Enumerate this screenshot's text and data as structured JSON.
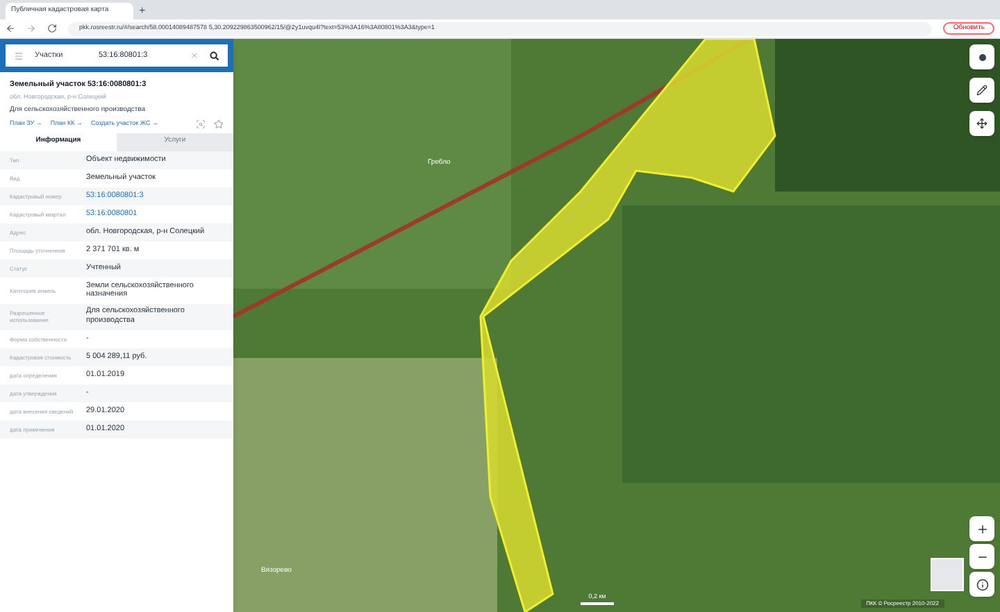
{
  "browser": {
    "tab_title": "Публичная кадастровая карта",
    "new_tab": "+",
    "url": "pkk.rosreestr.ru/#/search/58.00014089487578 5,30.209229863500962/15/@2y1uvqu4l?text=53%3A16%3A80801%3A3&type=1",
    "update_button": "Обновить"
  },
  "search": {
    "category": "Участки",
    "value": "53:16:80801:3"
  },
  "object": {
    "title": "Земельный участок 53:16:0080801:3",
    "subtitle": "обл. Новгородская, р-н Солецкий",
    "purpose": "Для сельскохозяйственного производства",
    "links": [
      "План ЗУ →",
      "План КК →",
      "Создать участок ЖС →"
    ]
  },
  "tabs": [
    {
      "label": "Информация",
      "selected": true
    },
    {
      "label": "Услуги",
      "selected": false
    }
  ],
  "rows": [
    {
      "label": "Тип",
      "value": "Объект недвижимости",
      "kind": "text"
    },
    {
      "label": "Вид",
      "value": "Земельный участок",
      "kind": "text"
    },
    {
      "label": "Кадастровый номер",
      "value": "53:16:0080801:3",
      "kind": "link"
    },
    {
      "label": "Кадастровый квартал",
      "value": "53:16:0080801",
      "kind": "link"
    },
    {
      "label": "Адрес",
      "value": "обл. Новгородская, р-н Солецкий",
      "kind": "text"
    },
    {
      "label": "Площадь уточненная",
      "value": "2 371 701 кв. м",
      "kind": "text"
    },
    {
      "label": "Статус",
      "value": "Учтенный",
      "kind": "text"
    },
    {
      "label": "Категория земель",
      "value": "Земли сельскохозяйственного назначения",
      "kind": "text"
    },
    {
      "label": "Разрешенное использование",
      "value": "Для сельскохозяйственного производства",
      "kind": "text"
    },
    {
      "label": "Форма собственности",
      "value": "-",
      "kind": "text"
    },
    {
      "label": "Кадастровая стоимость",
      "value": "5 004 289,11 руб.",
      "kind": "text"
    },
    {
      "label": "дата определения",
      "value": "01.01.2019",
      "kind": "text"
    },
    {
      "label": "дата утверждения",
      "value": "-",
      "kind": "text"
    },
    {
      "label": "дата внесения сведений",
      "value": "29.01.2020",
      "kind": "text"
    },
    {
      "label": "дата применения",
      "value": "01.01.2020",
      "kind": "text"
    }
  ],
  "map": {
    "places": [
      "Гребло",
      "Вязорево"
    ],
    "scale": "0,2 км",
    "attribution": "ПКК © Росреестр 2010-2022"
  }
}
